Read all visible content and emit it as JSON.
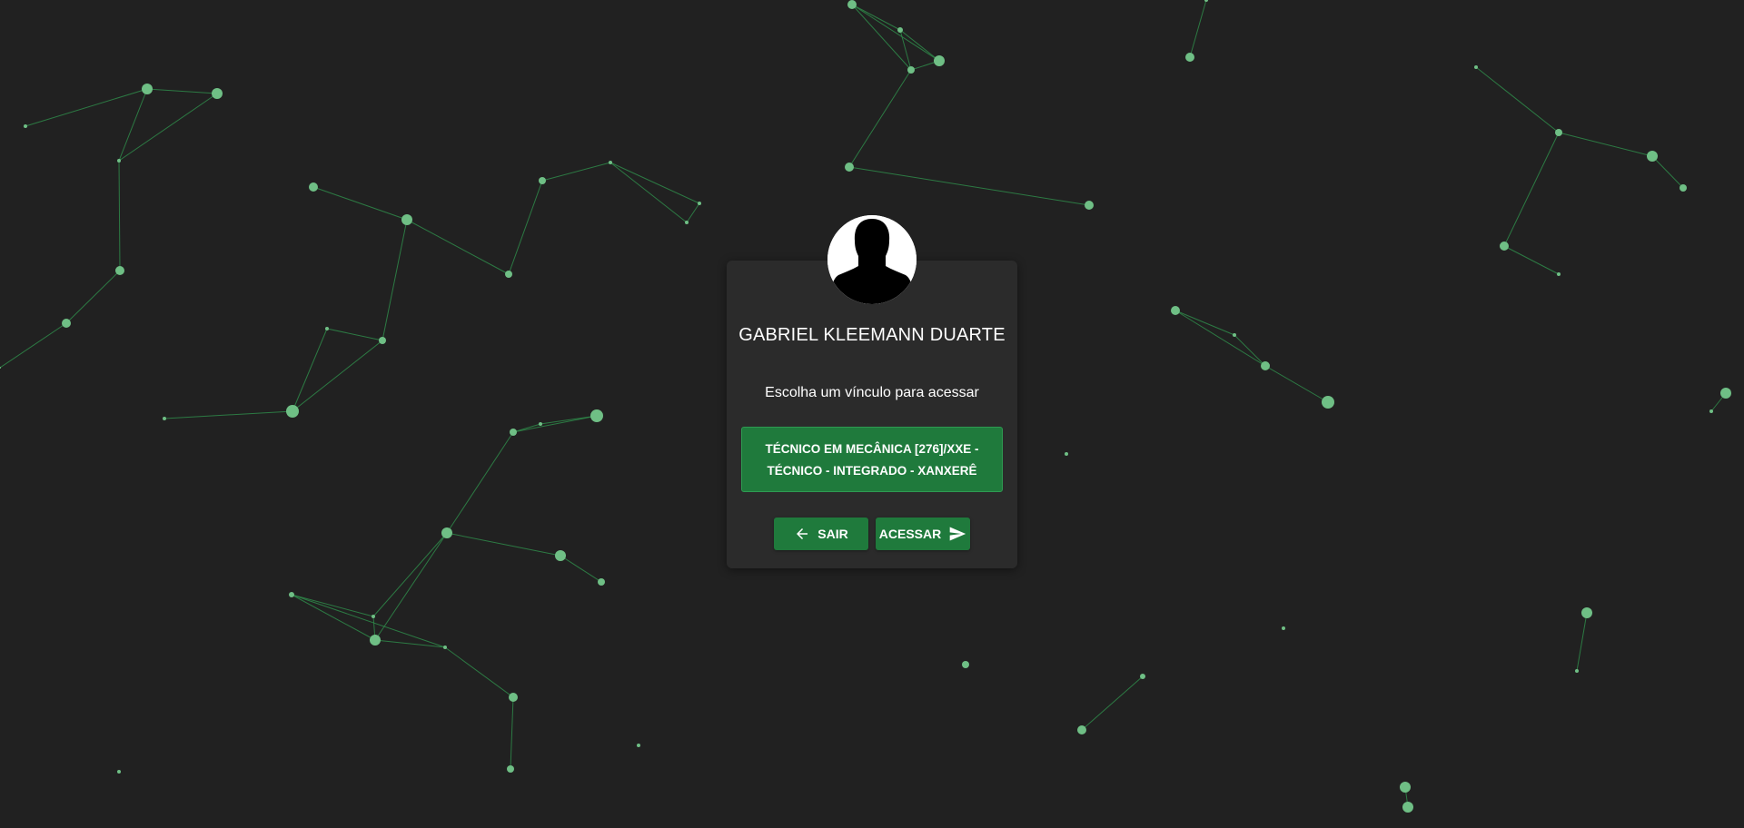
{
  "user": {
    "name": "GABRIEL KLEEMANN DUARTE"
  },
  "prompt": "Escolha um vínculo para acessar",
  "links": [
    {
      "line1": "TÉCNICO EM MECÂNICA [276]/XXE -",
      "line2": "TÉCNICO - INTEGRADO - XANXERÊ"
    }
  ],
  "buttons": {
    "exit_label": "SAIR",
    "exit_icon": "arrow-left-icon",
    "access_label": "ACESSAR",
    "access_icon": "send-icon"
  },
  "colors": {
    "background": "#212121",
    "card": "#2b2b2b",
    "accent": "#1f7a3c",
    "particle": "#6fbf85",
    "particle_line": "#2f8a4a"
  }
}
